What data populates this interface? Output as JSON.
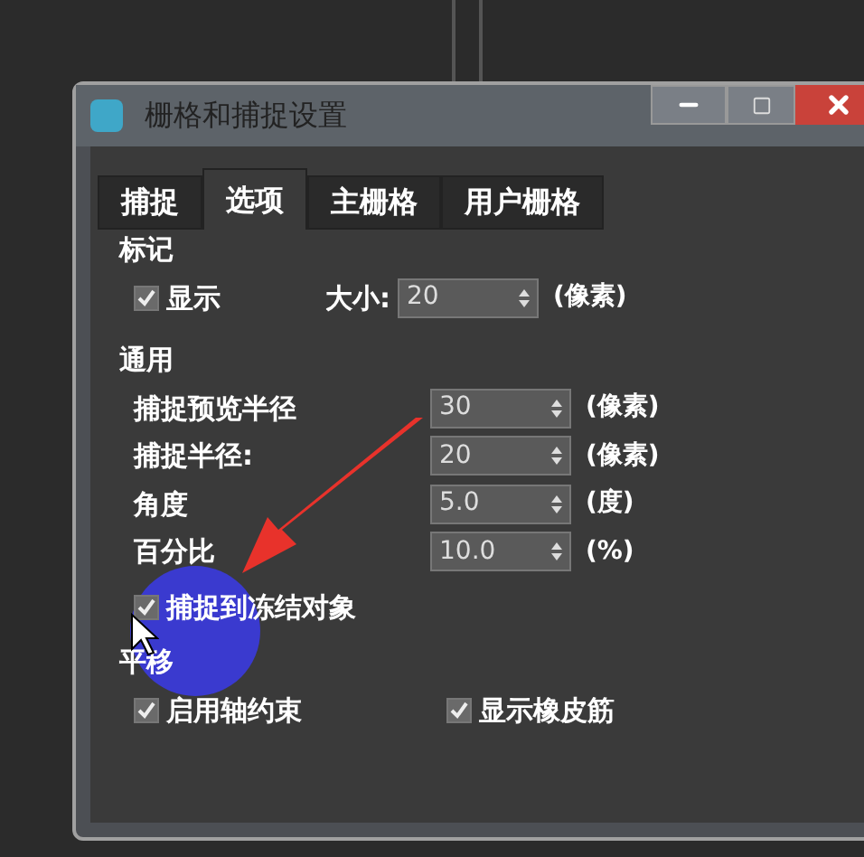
{
  "window": {
    "title": "栅格和捕捉设置"
  },
  "tabs": [
    {
      "label": "捕捉",
      "selected": false
    },
    {
      "label": "选项",
      "selected": true
    },
    {
      "label": "主栅格",
      "selected": false
    },
    {
      "label": "用户栅格",
      "selected": false
    }
  ],
  "marker_group": {
    "title": "标记",
    "show": {
      "label": "显示",
      "checked": true
    },
    "size": {
      "label": "大小:",
      "value": "20",
      "unit": "(像素)"
    }
  },
  "general_group": {
    "title": "通用",
    "fields": [
      {
        "label": "捕捉预览半径",
        "value": "30",
        "unit": "(像素)"
      },
      {
        "label": "捕捉半径:",
        "value": "20",
        "unit": "(像素)"
      },
      {
        "label": "角度",
        "value": "5.0",
        "unit": "(度)"
      },
      {
        "label": "百分比",
        "value": "10.0",
        "unit": "(%)"
      }
    ],
    "freeze": {
      "label": "捕捉到冻结对象",
      "checked": true
    }
  },
  "translation_group": {
    "title": "平移",
    "checkboxes": [
      {
        "label": "启用轴约束",
        "checked": true
      },
      {
        "label": "显示橡皮筋",
        "checked": true
      }
    ]
  }
}
